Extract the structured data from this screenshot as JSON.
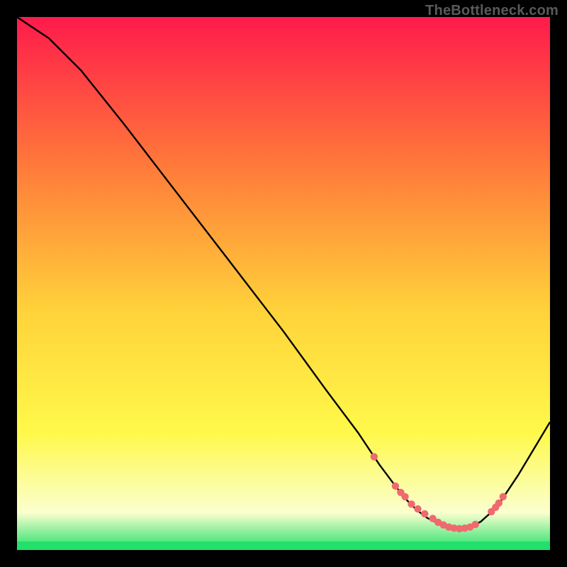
{
  "watermark": "TheBottleneck.com",
  "colors": {
    "bg_black": "#000000",
    "grad_top": "#ff1a4b",
    "grad_mid_upper": "#ff7a3a",
    "grad_mid": "#ffd23a",
    "grad_mid_lower": "#fff94a",
    "grad_pale": "#fbffcf",
    "grad_green": "#22e06a",
    "curve_stroke": "#000000",
    "marker_fill": "#ef6a6f",
    "marker_stroke": "#ef6a6f"
  },
  "chart_data": {
    "type": "line",
    "title": "",
    "xlabel": "",
    "ylabel": "",
    "xlim": [
      0,
      100
    ],
    "ylim": [
      0,
      100
    ],
    "series": [
      {
        "name": "bottleneck-curve",
        "x": [
          0,
          6,
          12,
          20,
          30,
          40,
          50,
          58,
          64,
          68,
          71,
          73,
          75,
          77,
          79,
          81,
          83,
          85,
          87,
          90,
          94,
          100
        ],
        "y": [
          100,
          96,
          90,
          80,
          67,
          54,
          41,
          30,
          22,
          16,
          12,
          9.5,
          7.5,
          6,
          5,
          4.3,
          4,
          4.3,
          5.3,
          8,
          14,
          24
        ]
      }
    ],
    "markers": {
      "name": "highlight-points",
      "x": [
        67,
        71,
        72,
        72.8,
        74,
        75.2,
        76.5,
        78,
        79,
        80,
        81,
        82,
        83,
        84,
        85,
        86,
        89,
        89.8,
        90.4,
        91.2
      ],
      "y": [
        17.5,
        12,
        10.8,
        10.0,
        8.6,
        7.7,
        6.8,
        5.9,
        5.2,
        4.7,
        4.3,
        4.1,
        4.0,
        4.1,
        4.3,
        4.8,
        7.2,
        8.0,
        8.8,
        10.0
      ]
    },
    "legend": false,
    "grid": false,
    "notes": "Background is a vertical red→yellow→green gradient with a thin emerald band at the bottom. Axis ticks and numeric labels are not shown; values are estimated on a 0–100 normalized scale in both dimensions, where y=0 is the bottom of the plot."
  }
}
